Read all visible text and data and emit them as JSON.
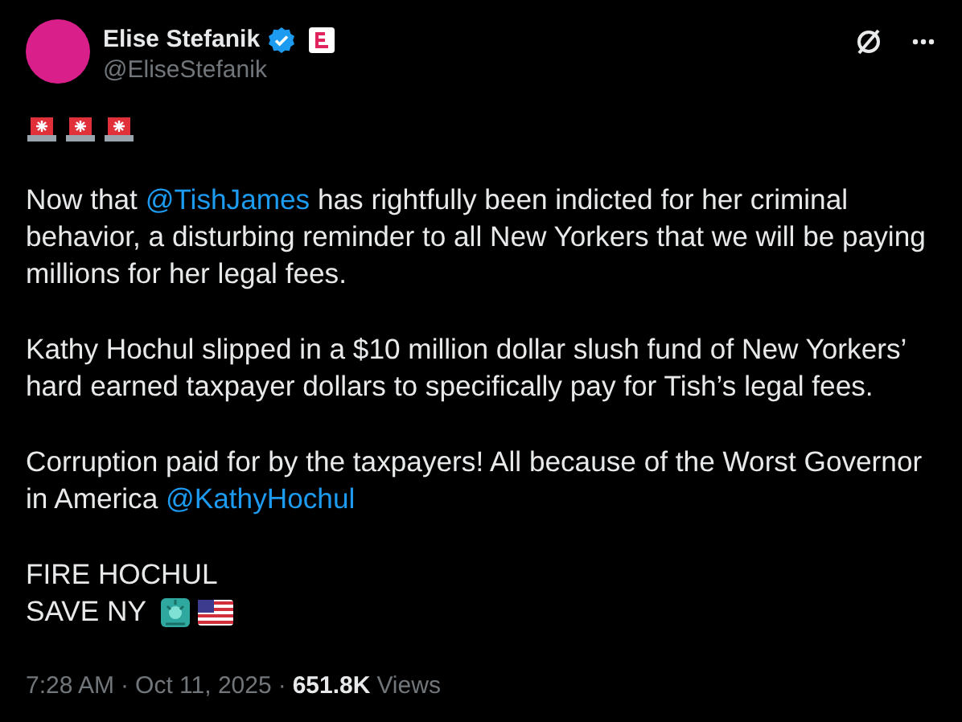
{
  "author": {
    "name": "Elise Stefanik",
    "verified": true,
    "handle": "@EliseStefanik"
  },
  "body": [
    {
      "kind": "emoji_row"
    },
    {
      "kind": "paragraph",
      "parts": [
        {
          "kind": "text",
          "text": "Now that "
        },
        {
          "kind": "mention",
          "text": "@TishJames"
        },
        {
          "kind": "text",
          "text": " has rightfully been indicted for her criminal behavior, a disturbing reminder to all New Yorkers that we will be paying millions for her legal fees."
        }
      ]
    },
    {
      "kind": "paragraph",
      "parts": [
        {
          "kind": "text",
          "text": "Kathy Hochul slipped in a $10 million dollar slush fund of New Yorkers’ hard earned taxpayer dollars to specifically pay for Tish’s legal fees."
        }
      ]
    },
    {
      "kind": "paragraph",
      "parts": [
        {
          "kind": "text",
          "text": "Corruption paid for by the taxpayers! All because of the Worst Governor in America "
        },
        {
          "kind": "mention",
          "text": "@KathyHochul"
        }
      ]
    },
    {
      "kind": "lines",
      "lines": [
        "FIRE HOCHUL",
        "SAVE NY"
      ]
    }
  ],
  "meta": {
    "time": "7:28 AM",
    "separator": "·",
    "date": "Oct 11, 2025",
    "views_count": "651.8K",
    "views_label": "Views"
  }
}
